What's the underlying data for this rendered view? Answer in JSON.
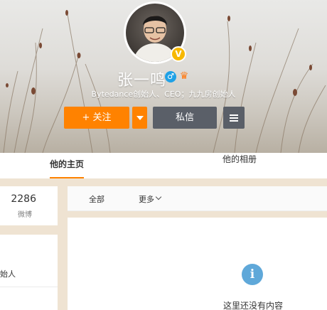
{
  "profile": {
    "name": "张一鸣",
    "bio": "Bytedance创始人、CEO；九九房创始人",
    "verified_badge": "V",
    "gender_icon": "male-icon",
    "member_icon": "vip-crown-icon"
  },
  "actions": {
    "follow_label": "+ 关注",
    "message_label": "私信",
    "follow_color": "#ff8200",
    "secondary_color": "#5a5f68"
  },
  "tabs": [
    {
      "label": "他的主页",
      "active": true
    },
    {
      "label": "他的相册",
      "active": false
    }
  ],
  "stats": {
    "weibo_count": "2286",
    "weibo_label": "微博"
  },
  "info": {
    "partial_text": "始人"
  },
  "filter": {
    "all_label": "全部",
    "more_label": "更多"
  },
  "feed": {
    "empty_text": "这里还没有内容"
  }
}
